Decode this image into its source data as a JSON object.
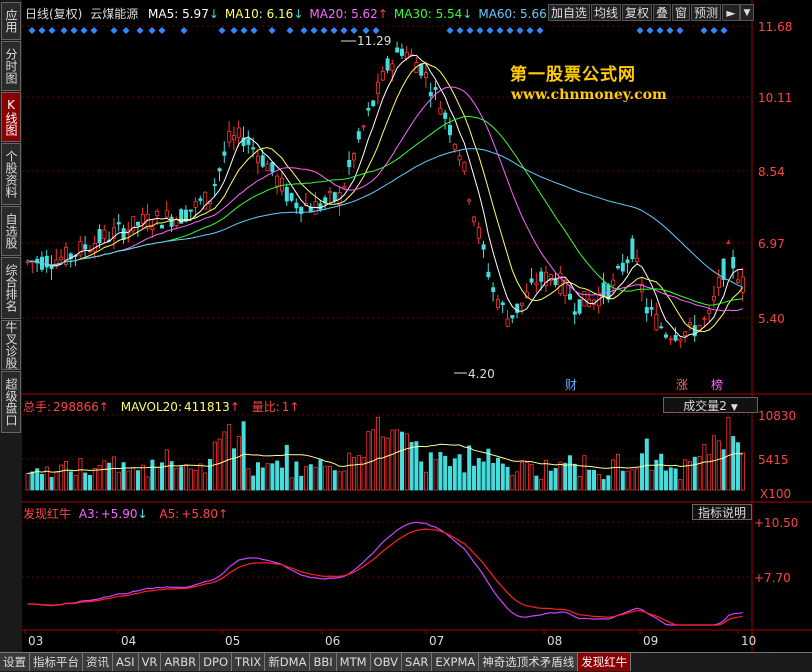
{
  "left_tabs": [
    {
      "label": "应用",
      "active": false
    },
    {
      "label": "分时图",
      "active": false
    },
    {
      "label": "K线图",
      "active": true
    },
    {
      "label": "个股资料",
      "active": false
    },
    {
      "label": "自选股",
      "active": false
    },
    {
      "label": "综合排名",
      "active": false
    },
    {
      "label": "牛叉诊股",
      "active": false
    },
    {
      "label": "超级盘口",
      "active": false
    }
  ],
  "header": {
    "period": "日线(复权)",
    "stock_name": "云煤能源",
    "ma": [
      {
        "label": "MA5:",
        "value": "5.97",
        "arrow": "↓",
        "color": "#ffffff"
      },
      {
        "label": "MA10:",
        "value": "6.16",
        "arrow": "↓",
        "color": "#ffff66"
      },
      {
        "label": "MA20:",
        "value": "5.62",
        "arrow": "↑",
        "color": "#ff66ff"
      },
      {
        "label": "MA30:",
        "value": "5.54",
        "arrow": "↓",
        "color": "#33ff33"
      },
      {
        "label": "MA60:",
        "value": "5.66",
        "arrow": "↑",
        "color": "#66ccff"
      }
    ],
    "buttons": [
      "加自选",
      "均线",
      "复权",
      "叠",
      "窗",
      "预测"
    ],
    "nav_icons": [
      "arrow-icon",
      "dropdown-icon"
    ]
  },
  "price_axis": [
    "11.68",
    "10.11",
    "8.54",
    "6.97",
    "5.40"
  ],
  "volume_axis": [
    "10830",
    "5415",
    "X100"
  ],
  "indicator_axis": [
    "+10.50",
    "+7.70"
  ],
  "annotations": {
    "high": "11.29",
    "low": "4.20",
    "events": [
      "财",
      "涨",
      "榜"
    ]
  },
  "watermark": {
    "line1": "第一股票公式网",
    "line2": "www.chnmoney.com"
  },
  "volume_header": {
    "total_label": "总手:",
    "total_value": "298866",
    "total_arrow": "↑",
    "mavol_label": "MAVOL20:",
    "mavol_value": "411813",
    "mavol_arrow": "↑",
    "ratio_label": "量比:",
    "ratio_value": "1",
    "ratio_arrow": "↑",
    "selector": "成交量2"
  },
  "indicator_header": {
    "name": "发现红牛",
    "a3_label": "A3:",
    "a3_value": "+5.90",
    "a3_arrow": "↓",
    "a5_label": "A5:",
    "a5_value": "+5.80",
    "a5_arrow": "↑",
    "button": "指标说明"
  },
  "months": [
    "03",
    "04",
    "05",
    "06",
    "07",
    "08",
    "09",
    "10"
  ],
  "bottom_tabs": [
    {
      "label": "设置",
      "active": false
    },
    {
      "label": "指标平台",
      "active": false
    },
    {
      "label": "资讯",
      "active": false
    },
    {
      "label": "ASI",
      "active": false
    },
    {
      "label": "VR",
      "active": false
    },
    {
      "label": "ARBR",
      "active": false
    },
    {
      "label": "DPO",
      "active": false
    },
    {
      "label": "TRIX",
      "active": false
    },
    {
      "label": "新DMA",
      "active": false
    },
    {
      "label": "BBI",
      "active": false
    },
    {
      "label": "MTM",
      "active": false
    },
    {
      "label": "OBV",
      "active": false
    },
    {
      "label": "SAR",
      "active": false
    },
    {
      "label": "EXPMA",
      "active": false
    },
    {
      "label": "神奇选顶术矛盾线",
      "active": false
    },
    {
      "label": "发现红牛",
      "active": true
    }
  ],
  "colors": {
    "up": "#ff3333",
    "down": "#44dddd",
    "grid": "#990000",
    "axis_text": "#ff4444"
  }
}
